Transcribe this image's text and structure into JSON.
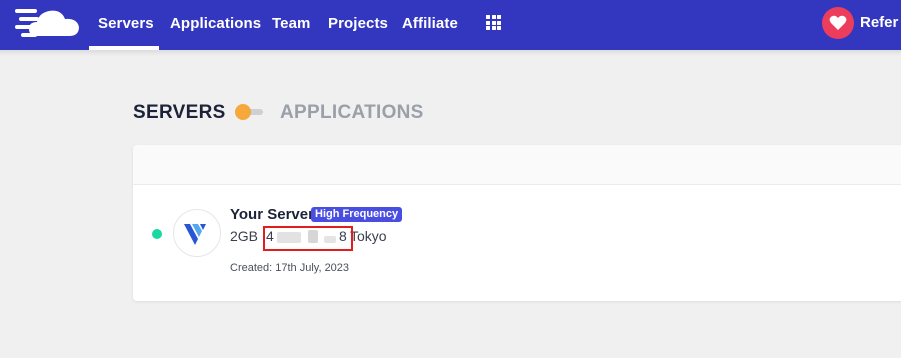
{
  "nav": {
    "logo_icon": "cloud-logo-icon",
    "items": [
      {
        "label": "Servers",
        "active": true
      },
      {
        "label": "Applications"
      },
      {
        "label": "Team"
      },
      {
        "label": "Projects"
      },
      {
        "label": "Affiliate"
      }
    ],
    "apps_icon": "grid-icon",
    "refer_icon": "heart-icon",
    "refer_label": "Refer &"
  },
  "view_toggle": {
    "left_label": "SERVERS",
    "right_label": "APPLICATIONS",
    "selected": "SERVERS"
  },
  "server": {
    "status": "running",
    "provider_icon": "vultr-logo-icon",
    "name": "Your Server",
    "badge": "High Frequency",
    "size": "2GB",
    "ip_visible_start": "4",
    "ip_visible_end": "8",
    "location": "Tokyo",
    "created": "Created: 17th July, 2023"
  },
  "colors": {
    "nav_bg": "#3337c0",
    "accent": "#4a4ee0",
    "status_green": "#19d8a0",
    "toggle_orange": "#f6a83a",
    "heart_red": "#ec3e5c",
    "highlight_red": "#e11d1d"
  }
}
